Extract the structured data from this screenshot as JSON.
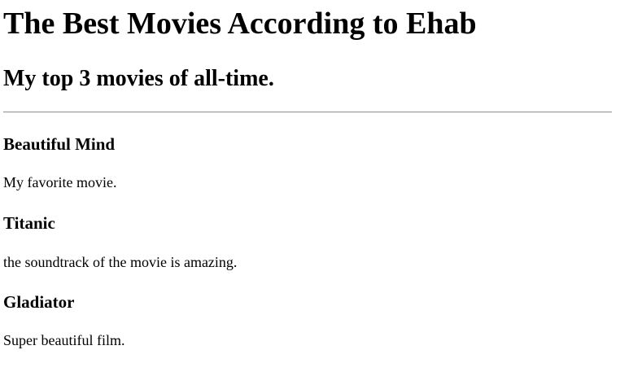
{
  "page": {
    "heading": "The Best Movies According to Ehab",
    "subheading": "My top 3 movies of all-time."
  },
  "movies": [
    {
      "title": "Beautiful Mind",
      "description": "My favorite movie."
    },
    {
      "title": "Titanic",
      "description": "the soundtrack of the movie is amazing."
    },
    {
      "title": "Gladiator",
      "description": "Super beautiful film."
    }
  ]
}
